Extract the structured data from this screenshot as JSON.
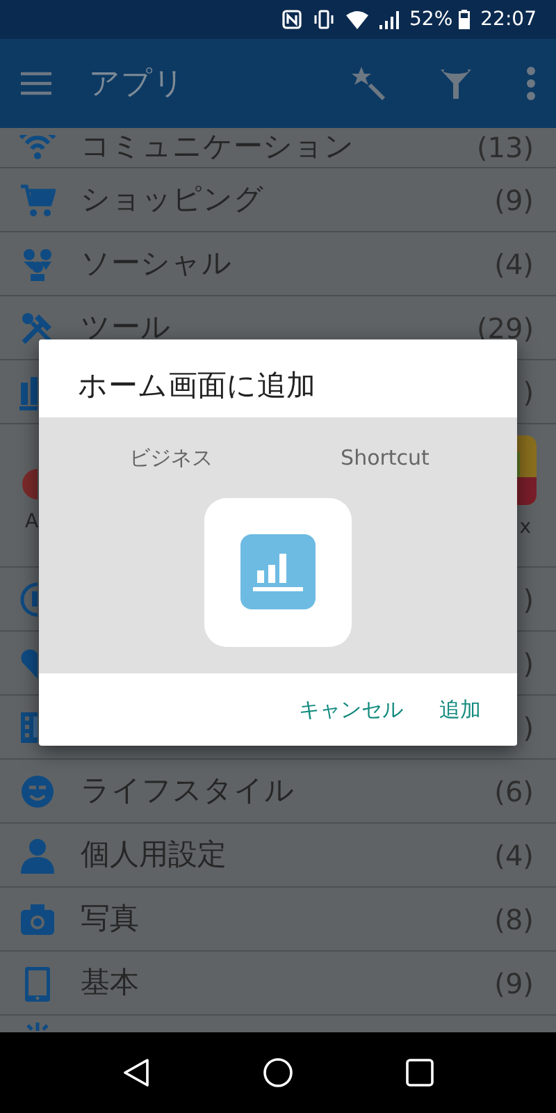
{
  "status_bar": {
    "battery": "52%",
    "time": "22:07"
  },
  "app_bar": {
    "title": "アプリ"
  },
  "list": [
    {
      "kind": "category",
      "label": "コミュニケーション",
      "count": "(13)"
    },
    {
      "kind": "category",
      "label": "ショッピング",
      "count": "(9)"
    },
    {
      "kind": "category",
      "label": "ソーシャル",
      "count": "(4)"
    },
    {
      "kind": "category",
      "label": "ツール",
      "count": "(29)"
    },
    {
      "kind": "category",
      "count": ")"
    },
    {
      "kind": "apps",
      "labels": [
        "A",
        "x"
      ]
    },
    {
      "kind": "category",
      "count": ")"
    },
    {
      "kind": "category",
      "count": ")"
    },
    {
      "kind": "category",
      "count": ")"
    },
    {
      "kind": "category",
      "label": "ライフスタイル",
      "count": "(6)"
    },
    {
      "kind": "category",
      "label": "個人用設定",
      "count": "(4)"
    },
    {
      "kind": "category",
      "label": "写真",
      "count": "(8)"
    },
    {
      "kind": "category",
      "label": "基本",
      "count": "(9)"
    },
    {
      "kind": "category"
    }
  ],
  "dialog": {
    "title": "ホーム画面に追加",
    "preview_labels": [
      "ビジネス",
      "Shortcut"
    ],
    "buttons": [
      "キャンセル",
      "追加"
    ]
  }
}
